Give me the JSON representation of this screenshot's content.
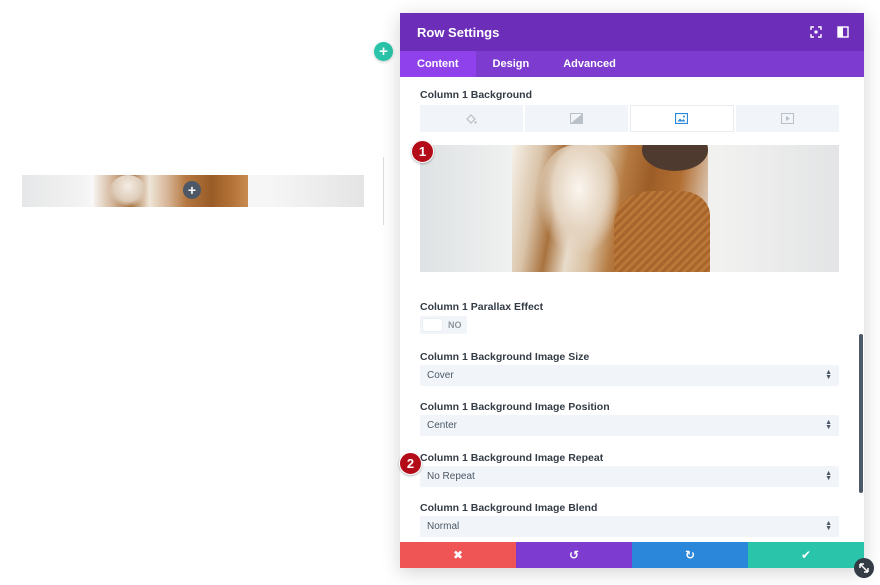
{
  "modal": {
    "title": "Row Settings",
    "tabs": [
      {
        "label": "Content",
        "active": true
      },
      {
        "label": "Design",
        "active": false
      },
      {
        "label": "Advanced",
        "active": false
      }
    ]
  },
  "fields": {
    "background_label": "Column 1 Background",
    "background_types": [
      "color-icon",
      "gradient-icon",
      "image-icon",
      "video-icon"
    ],
    "background_active_type": "image-icon",
    "parallax_label": "Column 1 Parallax Effect",
    "parallax_value": "NO",
    "size_label": "Column 1 Background Image Size",
    "size_value": "Cover",
    "position_label": "Column 1 Background Image Position",
    "position_value": "Center",
    "repeat_label": "Column 1 Background Image Repeat",
    "repeat_value": "No Repeat",
    "blend_label": "Column 1 Background Image Blend",
    "blend_value": "Normal"
  },
  "markers": [
    "1",
    "2"
  ],
  "canvas": {
    "add_section_glyph": "+",
    "add_module_glyph": "+"
  },
  "footer": {
    "cancel_glyph": "✖",
    "undo_glyph": "↺",
    "redo_glyph": "↻",
    "save_glyph": "✔"
  },
  "colors": {
    "header": "#6c2eb9",
    "tabs": "#7e3bd0",
    "cancel": "#ef5555",
    "undo": "#7e3bd0",
    "redo": "#2b87da",
    "save": "#29c4a9",
    "marker": "#b30b17"
  }
}
